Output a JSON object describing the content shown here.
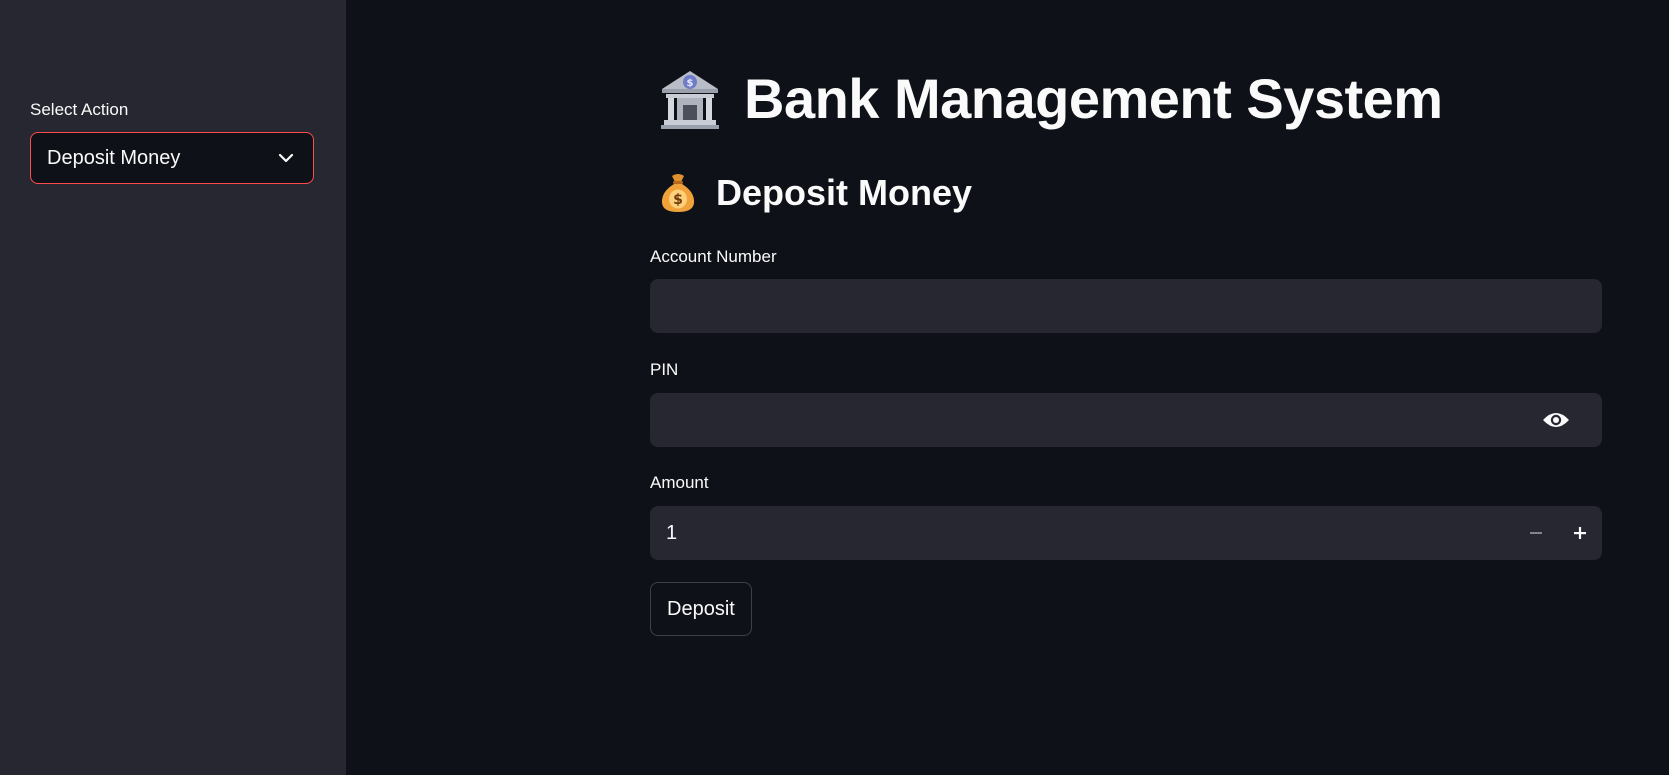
{
  "sidebar": {
    "select_label": "Select Action",
    "select_value": "Deposit Money"
  },
  "main": {
    "title": "Bank Management System",
    "title_icon": "bank-building-icon",
    "subtitle": "Deposit Money",
    "subtitle_icon": "money-bag-icon",
    "fields": {
      "account_number": {
        "label": "Account Number",
        "value": ""
      },
      "pin": {
        "label": "PIN",
        "value": ""
      },
      "amount": {
        "label": "Amount",
        "value": "1"
      }
    },
    "submit_label": "Deposit"
  },
  "colors": {
    "background": "#0e1117",
    "sidebar": "#262730",
    "input_bg": "#262730",
    "accent": "#ff4b4b",
    "text": "#fafafa"
  }
}
